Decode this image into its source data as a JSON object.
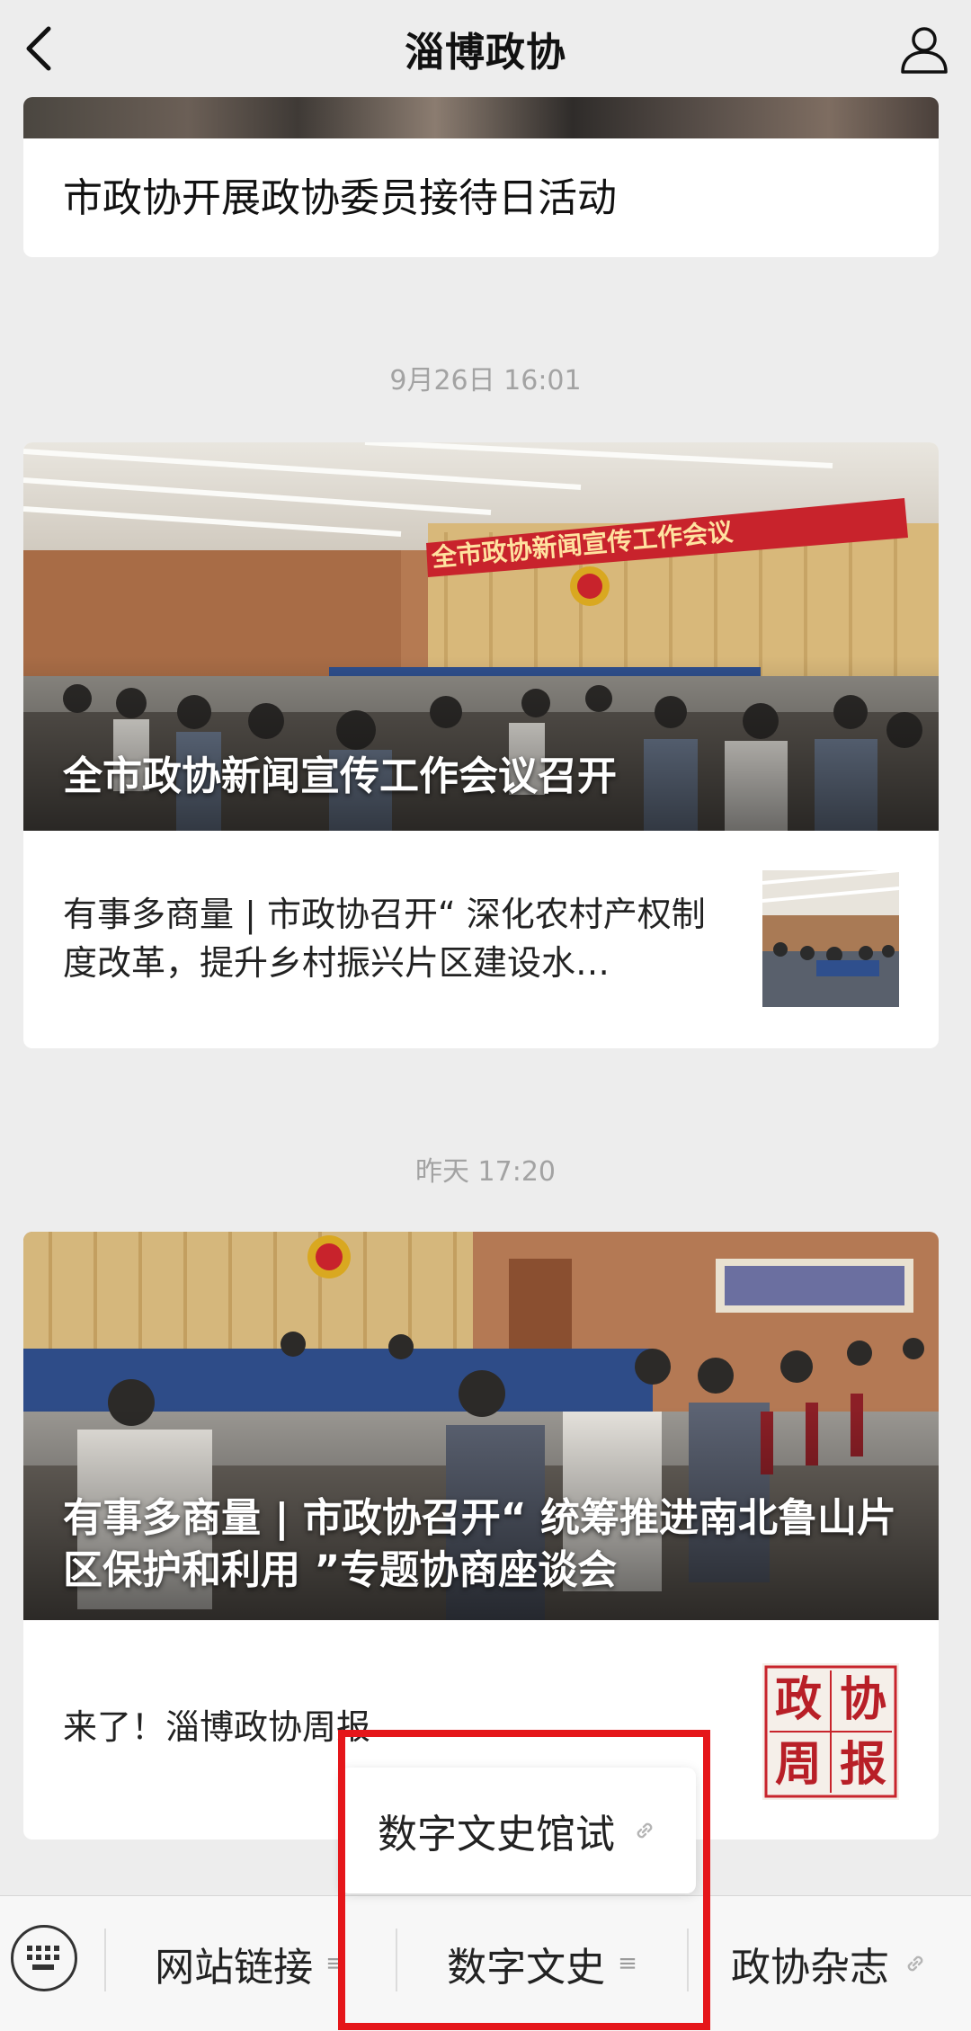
{
  "header": {
    "title": "淄博政协"
  },
  "feed": {
    "card0": {
      "headline": "市政协开展政协委员接待日活动"
    },
    "time1": "9月26日 16:01",
    "card1": {
      "banner_text": "全市政协新闻宣传工作会议",
      "main_title": "全市政协新闻宣传工作会议召开",
      "sub_title": "有事多商量 | 市政协召开“ 深化农村产权制度改革，提升乡村振兴片区建设水…"
    },
    "time2": "昨天 17:20",
    "card2": {
      "main_title": "有事多商量 | 市政协召开“ 统筹推进南北鲁山片区保护和利用 ”专题协商座谈会",
      "sub_title": "来了！淄博政协周报",
      "thumb_chars": [
        "政",
        "协",
        "周",
        "报"
      ]
    }
  },
  "popup": {
    "item": "数字文史馆试"
  },
  "bottom_menu": {
    "items": [
      {
        "label": "网站链接",
        "icon": "menu-lines-icon"
      },
      {
        "label": "数字文史",
        "icon": "menu-lines-icon"
      },
      {
        "label": "政协杂志",
        "icon": "link-icon"
      }
    ]
  },
  "colors": {
    "highlight": "#e5161a",
    "banner": "#c8232c"
  }
}
